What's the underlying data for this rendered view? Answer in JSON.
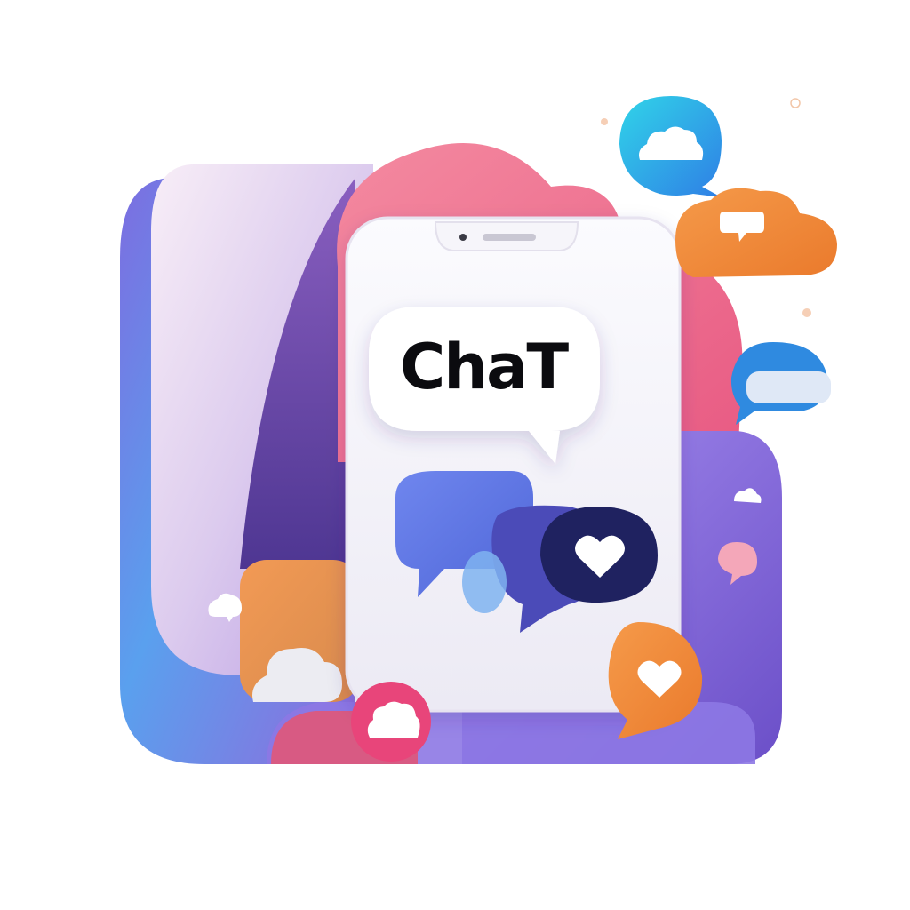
{
  "headline": "ChaT",
  "icons": {
    "main": "chat-bubble-icon",
    "heart": "heart-icon",
    "cloud": "cloud-icon"
  },
  "colors": {
    "purple": "#6f4ec9",
    "blue": "#4aa3e8",
    "pink": "#f06a8a",
    "orange": "#f08a35",
    "navy": "#1f2260",
    "phone": "#f3f2f8"
  }
}
